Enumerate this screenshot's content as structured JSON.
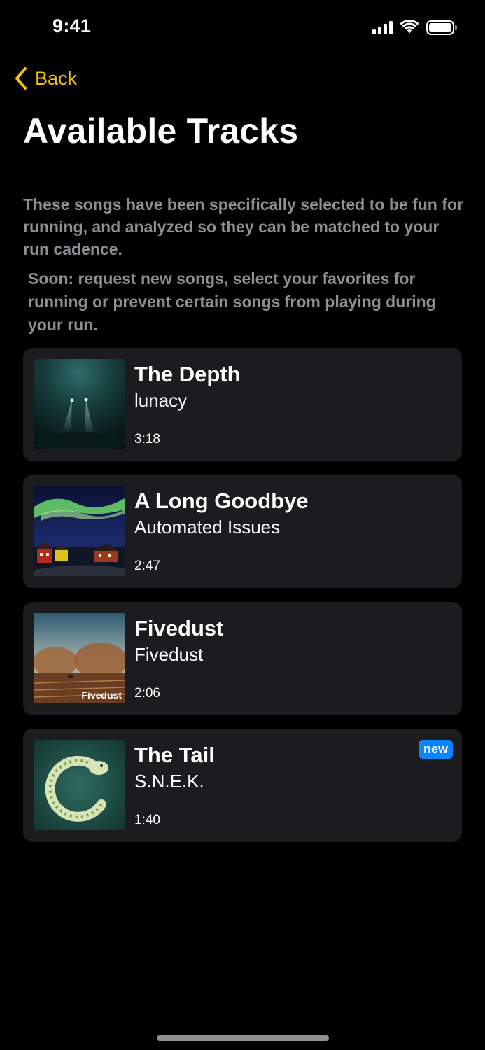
{
  "status_bar": {
    "time": "9:41"
  },
  "nav": {
    "back_label": "Back"
  },
  "page": {
    "title": "Available Tracks",
    "description": "These songs have been specifically selected to be fun for running, and analyzed so they can be matched to your run cadence.",
    "note": "Soon: request new songs, select your favorites for running or prevent certain songs from playing during your run."
  },
  "tracks": [
    {
      "title": "The Depth",
      "artist": "lunacy",
      "duration": "3:18"
    },
    {
      "title": "A Long Goodbye",
      "artist": "Automated Issues",
      "duration": "2:47"
    },
    {
      "title": "Fivedust",
      "artist": "Fivedust",
      "duration": "2:06",
      "artwork_text": "Fivedust"
    },
    {
      "title": "The Tail",
      "artist": "S.N.E.K.",
      "duration": "1:40",
      "badge": "new"
    }
  ],
  "colors": {
    "accent": "#f5c010",
    "card": "#1c1c1e",
    "secondary_text": "#8e8e93",
    "badge": "#0a84ff"
  }
}
